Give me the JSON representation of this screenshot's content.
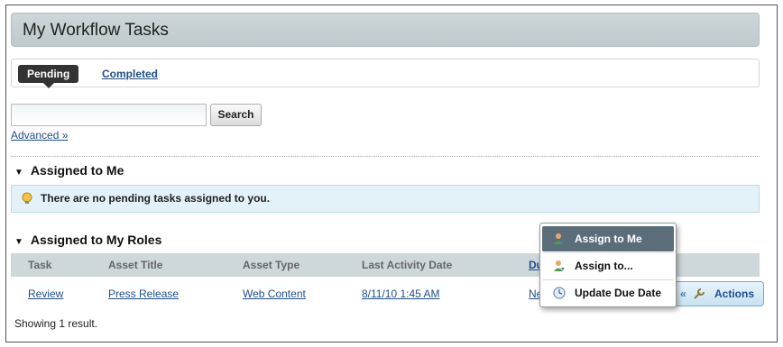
{
  "portlet": {
    "title": "My Workflow Tasks"
  },
  "tabs": [
    {
      "label": "Pending",
      "active": true
    },
    {
      "label": "Completed",
      "active": false
    }
  ],
  "search": {
    "value": "",
    "button_label": "Search",
    "advanced_label": "Advanced »"
  },
  "assigned_to_me": {
    "header": "Assigned to Me",
    "message": "There are no pending tasks assigned to you."
  },
  "assigned_to_roles": {
    "header": "Assigned to My Roles",
    "columns": [
      "Task",
      "Asset Title",
      "Asset Type",
      "Last Activity Date",
      "Du"
    ],
    "rows": [
      {
        "task": "Review",
        "asset_title": "Press Release",
        "asset_type": "Web Content",
        "last_activity": "8/11/10 1:45 AM",
        "due": "Ne"
      }
    ],
    "actions_label": "Actions",
    "result_count": "Showing 1 result."
  },
  "actions_menu": {
    "items": [
      {
        "label": "Assign to Me",
        "icon": "user-assign-icon",
        "highlighted": true
      },
      {
        "label": "Assign to...",
        "icon": "user-assign-icon",
        "highlighted": false
      },
      {
        "label": "Update Due Date",
        "icon": "clock-icon",
        "highlighted": false
      }
    ]
  },
  "colors": {
    "title_bar": "#c5cfd2",
    "tab_active": "#333333",
    "link": "#1e4e8c",
    "info_box": "#e3f1f9",
    "menu_highlight": "#5c6d7a"
  }
}
